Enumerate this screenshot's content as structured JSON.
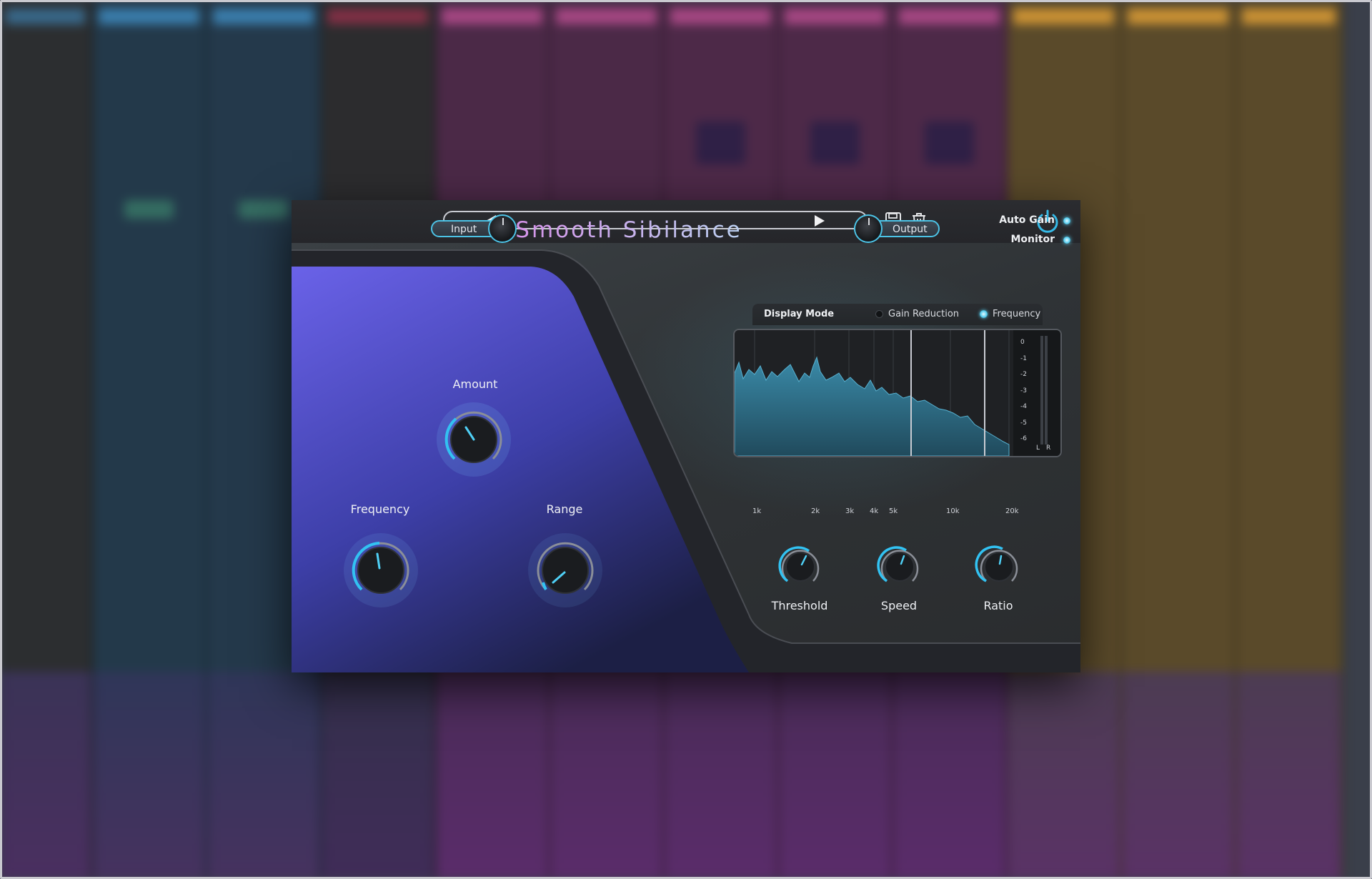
{
  "plugin": {
    "title": "Smooth Sibilance",
    "preset_name": "",
    "input_label": "Input",
    "output_label": "Output",
    "auto_gain_label": "Auto Gain",
    "monitor_label": "Monitor",
    "accent_color": "#4cc3e6"
  },
  "toolbar": {
    "prev_icon": "triangle-left-icon",
    "next_icon": "triangle-right-icon",
    "save_icon": "floppy-disk-icon",
    "delete_icon": "trash-icon",
    "power_icon": "power-icon"
  },
  "knobs": {
    "amount": {
      "label": "Amount"
    },
    "frequency": {
      "label": "Frequency"
    },
    "range": {
      "label": "Range"
    },
    "threshold": {
      "label": "Threshold"
    },
    "speed": {
      "label": "Speed"
    },
    "ratio": {
      "label": "Ratio"
    }
  },
  "display": {
    "mode_label": "Display Mode",
    "options": [
      "Gain Reduction",
      "Frequency"
    ],
    "selected": "Frequency",
    "freq_ticks": [
      "1k",
      "2k",
      "3k",
      "4k",
      "5k",
      "10k",
      "20k"
    ],
    "meter_ticks": [
      "0",
      "-1",
      "-2",
      "-3",
      "-4",
      "-5",
      "-6"
    ],
    "meter_channels": [
      "L",
      "R"
    ]
  }
}
